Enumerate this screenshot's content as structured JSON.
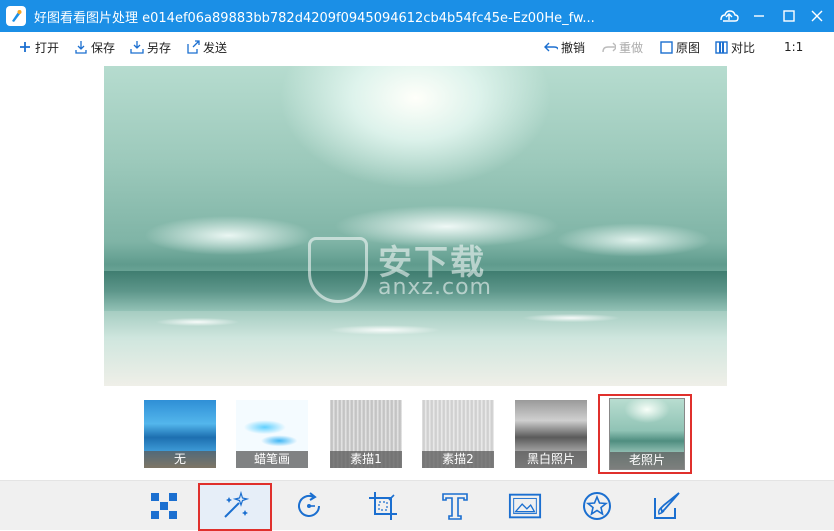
{
  "window": {
    "title": "好图看看图片处理 e014ef06a89883bb782d4209f0945094612cb4b54fc45e-Ez00He_fw..."
  },
  "toolbar": {
    "open": "打开",
    "save": "保存",
    "save_as": "另存",
    "send": "发送",
    "undo": "撤销",
    "redo": "重做",
    "original": "原图",
    "compare": "对比",
    "ratio": "1:1"
  },
  "watermark": {
    "cn": "安下载",
    "en": "anxz.com"
  },
  "filters": [
    {
      "label": "无"
    },
    {
      "label": "蜡笔画"
    },
    {
      "label": "素描1"
    },
    {
      "label": "素描2"
    },
    {
      "label": "黑白照片"
    },
    {
      "label": "老照片"
    }
  ],
  "selected_filter": "老照片",
  "colors": {
    "titlebar": "#1b8fe6",
    "accent": "#1b6fd0",
    "selection": "#e0302c"
  },
  "bottom_tools": [
    {
      "icon": "mosaic-icon"
    },
    {
      "icon": "magic-wand-icon"
    },
    {
      "icon": "rotate-icon"
    },
    {
      "icon": "crop-icon"
    },
    {
      "icon": "text-icon"
    },
    {
      "icon": "frame-icon"
    },
    {
      "icon": "sticker-icon"
    },
    {
      "icon": "brush-icon"
    }
  ]
}
